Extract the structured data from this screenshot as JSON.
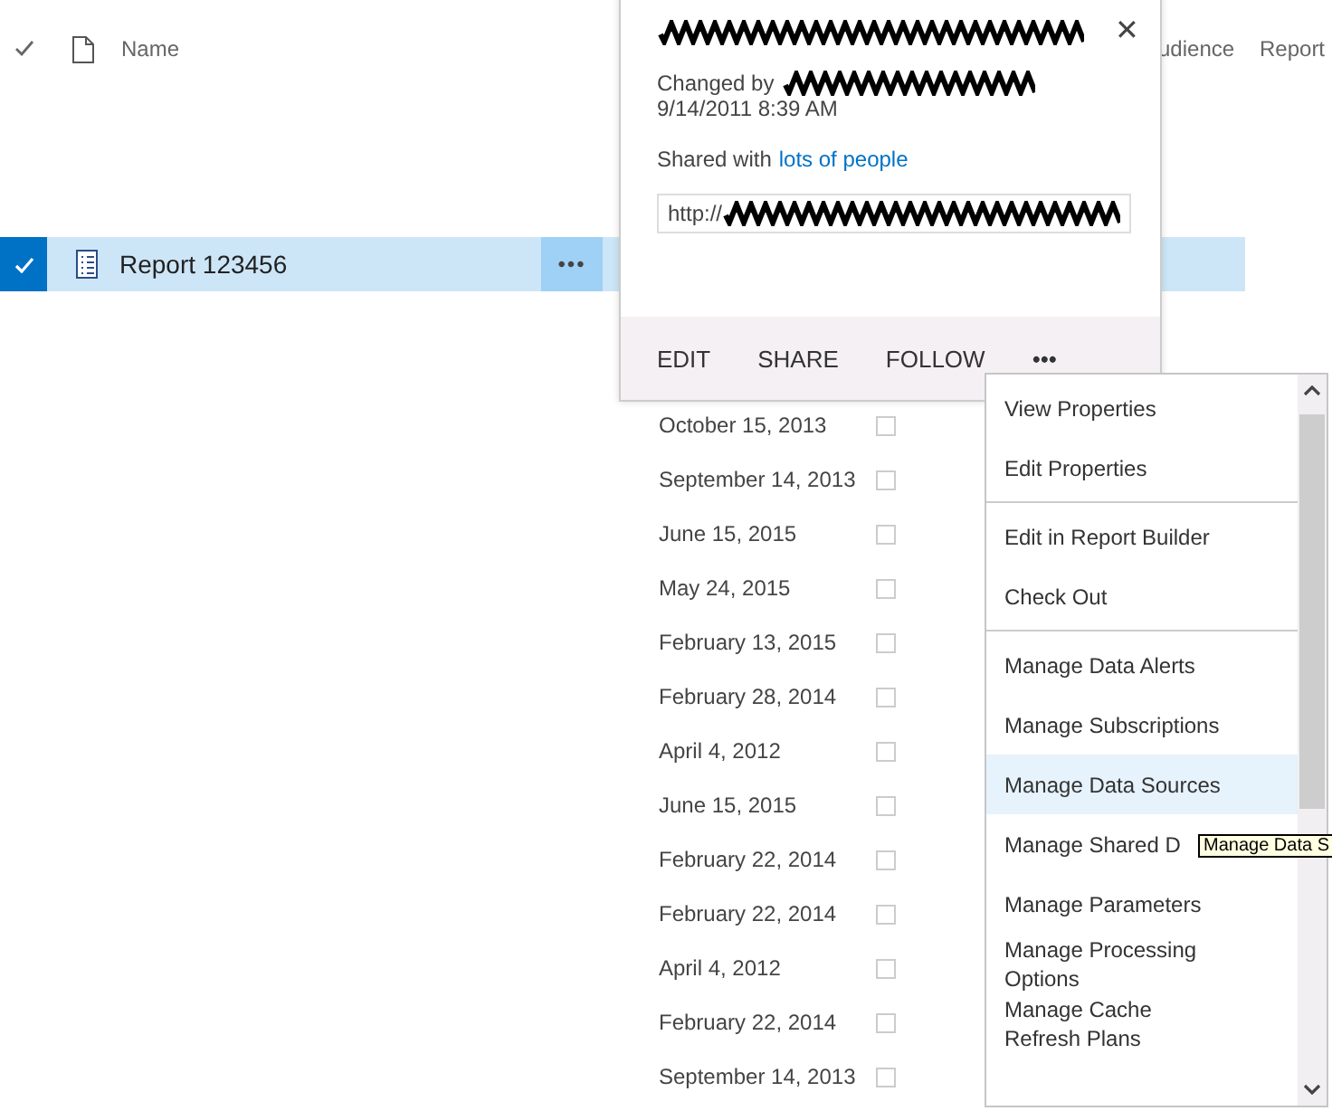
{
  "table": {
    "columns": [
      {
        "label": "Name"
      },
      {
        "label": "udience"
      },
      {
        "label": "Report"
      }
    ],
    "rows": [
      {
        "name": "Report 123456",
        "more": "•••",
        "date": "",
        "selected": true
      },
      {
        "name": "",
        "date": "October 15, 2013",
        "selected": false
      },
      {
        "name": "",
        "date": "September 14, 2013",
        "selected": false
      },
      {
        "name": "",
        "date": "June 15, 2015",
        "selected": false
      },
      {
        "name": "",
        "date": "May 24, 2015",
        "selected": false
      },
      {
        "name": "",
        "date": "February 13, 2015",
        "selected": false
      },
      {
        "name": "",
        "date": "February 28, 2014",
        "selected": false
      },
      {
        "name": "",
        "date": "April 4, 2012",
        "selected": false
      },
      {
        "name": "",
        "date": "June 15, 2015",
        "selected": false
      },
      {
        "name": "",
        "date": "February 22, 2014",
        "selected": false
      },
      {
        "name": "",
        "date": "February 22, 2014",
        "selected": false
      },
      {
        "name": "",
        "date": "April 4, 2012",
        "selected": false
      },
      {
        "name": "",
        "date": "February 22, 2014",
        "selected": false
      },
      {
        "name": "",
        "date": "September 14, 2013",
        "selected": false
      }
    ]
  },
  "callout": {
    "close": "✕",
    "changed_by": "Changed by",
    "changed_at": "9/14/2011 8:39 AM",
    "shared_with": "Shared with",
    "shared_link": "lots of people",
    "url": "http://",
    "actions": [
      "EDIT",
      "SHARE",
      "FOLLOW",
      "•••"
    ]
  },
  "menu": {
    "sections": [
      {
        "items": [
          {
            "label": "View Properties",
            "selected": false
          },
          {
            "label": "Edit Properties",
            "selected": false
          }
        ]
      },
      {
        "items": [
          {
            "label": "Edit in Report Builder",
            "selected": false
          },
          {
            "label": "Check Out",
            "selected": false
          }
        ]
      },
      {
        "items": [
          {
            "label": "Manage Data Alerts",
            "selected": false
          },
          {
            "label": "Manage Subscriptions",
            "selected": false
          },
          {
            "label": "Manage Data Sources",
            "selected": true
          },
          {
            "label": "Manage Shared D",
            "selected": false
          },
          {
            "label": "Manage Parameters",
            "selected": false
          },
          {
            "label": "Manage Processing Options",
            "selected": false
          },
          {
            "label": "Manage Cache Refresh Plans",
            "selected": false
          }
        ]
      }
    ]
  },
  "tooltip": "Manage Data S"
}
